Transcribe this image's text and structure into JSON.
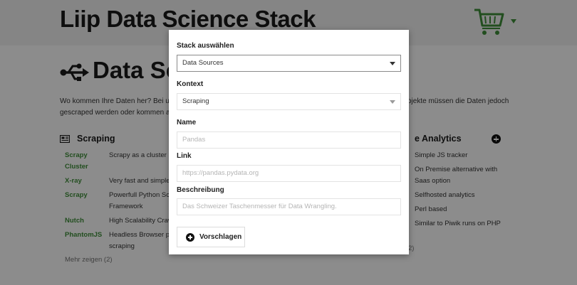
{
  "site": {
    "title": "Liip Data Science Stack"
  },
  "section": {
    "title": "Data Sources"
  },
  "intro": {
    "line1_left": "Wo kommen Ihre Daten her? Bei uns sin",
    "line1_right": "ojekte müssen die Daten jedoch",
    "line2_left": "gescraped werden oder kommen aus d"
  },
  "scraping": {
    "title": "Scraping",
    "tools": [
      {
        "name_line1": "Scrapy",
        "name_line2": "Cluster",
        "desc_line1": "Scrapy as a cluster",
        "desc_line2": ""
      },
      {
        "name_line1": "X-ray",
        "name_line2": "",
        "desc_line1": "Very fast and simple s",
        "desc_line2": ""
      },
      {
        "name_line1": "Scrapy",
        "name_line2": "",
        "desc_line1": "Powerfull Python Scra",
        "desc_line2": "Framework"
      },
      {
        "name_line1": "Nutch",
        "name_line2": "",
        "desc_line1": "High Scalability Craw",
        "desc_line2": ""
      },
      {
        "name_line1": "PhantomJS",
        "name_line2": "",
        "desc_line1": "Headless Browser pe",
        "desc_line2": "scraping"
      }
    ],
    "more": "Mehr zeigen (2)"
  },
  "analytics": {
    "title": "e Analytics",
    "items": [
      "Simple JS tracker",
      "On Premise alternative with",
      "Saas option",
      "Selfhosted analytics",
      "Perl based",
      "Similar to Piwik runs on PHP"
    ],
    "more": "2)"
  },
  "modal": {
    "stack_label": "Stack auswählen",
    "stack_value": "Data Sources",
    "context_label": "Kontext",
    "context_value": "Scraping",
    "name_label": "Name",
    "name_placeholder": "Pandas",
    "link_label": "Link",
    "link_placeholder": "https://pandas.pydata.org",
    "desc_label": "Beschreibung",
    "desc_placeholder": "Das Schweizer Taschenmesser für Data Wrangling.",
    "submit_label": "Vorschlagen"
  },
  "colors": {
    "accent_green": "#3f8f3a",
    "overlay": "rgba(0,0,0,0.45)"
  },
  "icons": [
    "shopping-cart-icon",
    "usb-icon",
    "newspaper-icon",
    "plus-circle-icon",
    "caret-down-icon"
  ]
}
